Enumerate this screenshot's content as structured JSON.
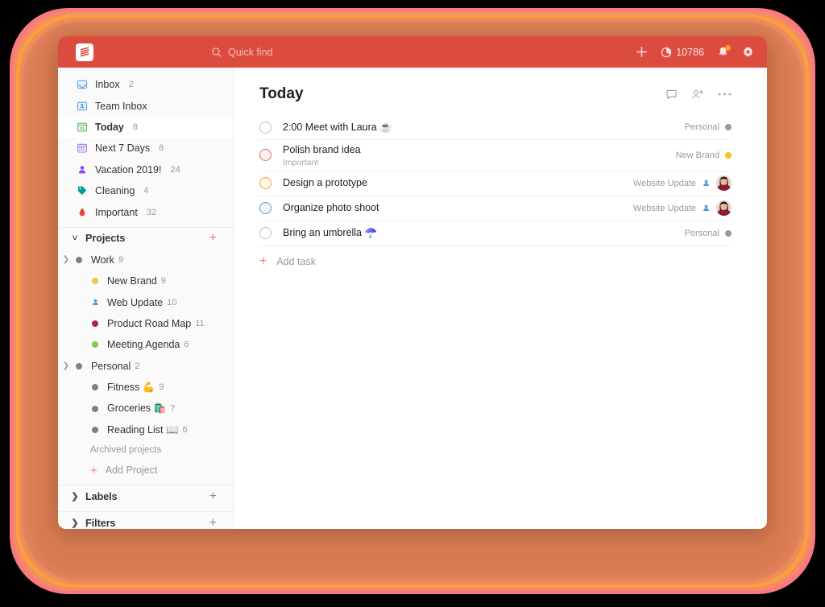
{
  "window": {
    "background_color": "#000000",
    "frame_colors": [
      "#f9797f",
      "#f58a6a",
      "#f9a03c",
      "#ef8b5c",
      "#d87a51"
    ],
    "accent_color": "#db4c3f"
  },
  "topbar": {
    "logo_name": "todoist-logo",
    "quick_find": {
      "placeholder": "Quick find",
      "icon": "search-icon"
    },
    "add_label": "+",
    "karma": {
      "icon": "productivity-icon",
      "value": "10786"
    },
    "notifications": {
      "icon": "bell-icon",
      "has_unread": true,
      "dot_color": "#ffa023"
    },
    "settings": {
      "icon": "gear-icon"
    }
  },
  "sidebar": {
    "nav_items": [
      {
        "label": "Inbox",
        "count": "2",
        "icon": "inbox-icon",
        "color": "#5297e0",
        "active": false
      },
      {
        "label": "Team Inbox",
        "count": "",
        "icon": "team-inbox-icon",
        "color": "#5297e0",
        "active": false
      },
      {
        "label": "Today",
        "count": "8",
        "icon": "calendar-today-icon",
        "color": "#4caf50",
        "active": true
      },
      {
        "label": "Next 7 Days",
        "count": "8",
        "icon": "calendar-week-icon",
        "color": "#9d78d8",
        "active": false
      },
      {
        "label": "Vacation 2019!",
        "count": "24",
        "icon": "person-icon",
        "color": "#8a3ffc",
        "active": false
      },
      {
        "label": "Cleaning",
        "count": "4",
        "icon": "tag-icon",
        "color": "#009b9b",
        "active": false
      },
      {
        "label": "Important",
        "count": "32",
        "icon": "flame-icon",
        "color": "#e04b3a",
        "active": false
      }
    ],
    "projects_section": {
      "label": "Projects",
      "chevron": "chevron-down-icon",
      "add_icon": "plus-icon",
      "items": [
        {
          "name": "Work",
          "count": "9",
          "dot_color": "#808080",
          "indent": 0,
          "expandable": true,
          "icon": "dot-icon"
        },
        {
          "name": "New Brand",
          "count": "9",
          "dot_color": "#eec849",
          "indent": 1,
          "expandable": false,
          "icon": "dot-icon"
        },
        {
          "name": "Web Update",
          "count": "10",
          "dot_color": "#5297e0",
          "indent": 1,
          "expandable": false,
          "icon": "person-shared-icon"
        },
        {
          "name": "Product Road Map",
          "count": "11",
          "dot_color": "#b0244b",
          "indent": 1,
          "expandable": false,
          "icon": "dot-icon"
        },
        {
          "name": "Meeting Agenda",
          "count": "6",
          "dot_color": "#7ecc49",
          "indent": 1,
          "expandable": false,
          "icon": "dot-icon"
        },
        {
          "name": "Personal",
          "count": "2",
          "dot_color": "#808080",
          "indent": 0,
          "expandable": true,
          "icon": "dot-icon"
        },
        {
          "name": "Fitness 💪",
          "count": "9",
          "dot_color": "#808080",
          "indent": 1,
          "expandable": false,
          "icon": "dot-icon"
        },
        {
          "name": "Groceries 🛍️",
          "count": "7",
          "dot_color": "#808080",
          "indent": 1,
          "expandable": false,
          "icon": "dot-icon"
        },
        {
          "name": "Reading List 📖",
          "count": "6",
          "dot_color": "#808080",
          "indent": 1,
          "expandable": false,
          "icon": "dot-icon"
        }
      ],
      "archived_label": "Archived projects",
      "add_project_label": "Add Project"
    },
    "labels_section": {
      "label": "Labels",
      "chevron": "chevron-right-icon",
      "add_icon": "plus-icon"
    },
    "filters_section": {
      "label": "Filters",
      "chevron": "chevron-right-icon",
      "add_icon": "plus-icon"
    }
  },
  "main": {
    "title": "Today",
    "header_actions": [
      {
        "name": "comments-icon"
      },
      {
        "name": "add-person-icon"
      },
      {
        "name": "more-options-icon"
      }
    ],
    "tasks": [
      {
        "title": "2:00 Meet with Laura ☕",
        "subtitle": "",
        "priority_color": "#bdbdbd",
        "project": "Personal",
        "project_dot": "#9a9a9a",
        "shared": false,
        "avatar": false
      },
      {
        "title": "Polish brand idea",
        "subtitle": "Important",
        "priority_color": "#e06c64",
        "project": "New Brand",
        "project_dot": "#f5c518",
        "shared": false,
        "avatar": false
      },
      {
        "title": "Design a prototype",
        "subtitle": "",
        "priority_color": "#eba73c",
        "project": "Website Update",
        "project_dot": "",
        "shared": true,
        "avatar": true
      },
      {
        "title": "Organize photo shoot",
        "subtitle": "",
        "priority_color": "#5297e0",
        "project": "Website Update",
        "project_dot": "",
        "shared": true,
        "avatar": true
      },
      {
        "title": "Bring an umbrella ☂️",
        "subtitle": "",
        "priority_color": "#bdbdbd",
        "project": "Personal",
        "project_dot": "#9a9a9a",
        "shared": false,
        "avatar": false
      }
    ],
    "add_task_label": "Add task"
  }
}
